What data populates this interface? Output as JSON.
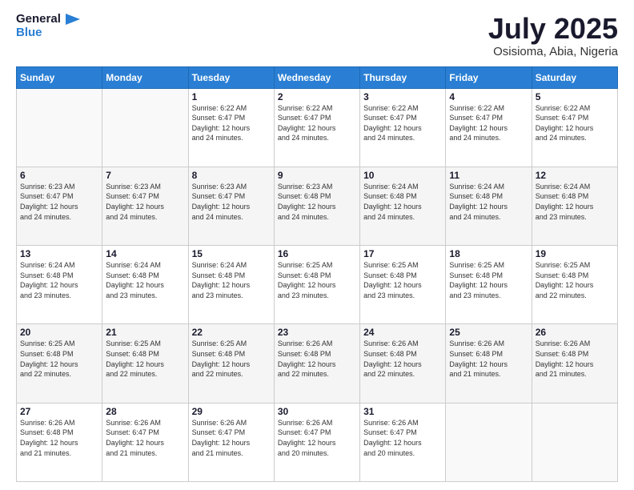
{
  "header": {
    "logo": {
      "line1": "General",
      "line2": "Blue"
    },
    "title": "July 2025",
    "subtitle": "Osisioma, Abia, Nigeria"
  },
  "weekdays": [
    "Sunday",
    "Monday",
    "Tuesday",
    "Wednesday",
    "Thursday",
    "Friday",
    "Saturday"
  ],
  "weeks": [
    [
      {
        "day": "",
        "info": ""
      },
      {
        "day": "",
        "info": ""
      },
      {
        "day": "1",
        "info": "Sunrise: 6:22 AM\nSunset: 6:47 PM\nDaylight: 12 hours\nand 24 minutes."
      },
      {
        "day": "2",
        "info": "Sunrise: 6:22 AM\nSunset: 6:47 PM\nDaylight: 12 hours\nand 24 minutes."
      },
      {
        "day": "3",
        "info": "Sunrise: 6:22 AM\nSunset: 6:47 PM\nDaylight: 12 hours\nand 24 minutes."
      },
      {
        "day": "4",
        "info": "Sunrise: 6:22 AM\nSunset: 6:47 PM\nDaylight: 12 hours\nand 24 minutes."
      },
      {
        "day": "5",
        "info": "Sunrise: 6:22 AM\nSunset: 6:47 PM\nDaylight: 12 hours\nand 24 minutes."
      }
    ],
    [
      {
        "day": "6",
        "info": "Sunrise: 6:23 AM\nSunset: 6:47 PM\nDaylight: 12 hours\nand 24 minutes."
      },
      {
        "day": "7",
        "info": "Sunrise: 6:23 AM\nSunset: 6:47 PM\nDaylight: 12 hours\nand 24 minutes."
      },
      {
        "day": "8",
        "info": "Sunrise: 6:23 AM\nSunset: 6:47 PM\nDaylight: 12 hours\nand 24 minutes."
      },
      {
        "day": "9",
        "info": "Sunrise: 6:23 AM\nSunset: 6:48 PM\nDaylight: 12 hours\nand 24 minutes."
      },
      {
        "day": "10",
        "info": "Sunrise: 6:24 AM\nSunset: 6:48 PM\nDaylight: 12 hours\nand 24 minutes."
      },
      {
        "day": "11",
        "info": "Sunrise: 6:24 AM\nSunset: 6:48 PM\nDaylight: 12 hours\nand 24 minutes."
      },
      {
        "day": "12",
        "info": "Sunrise: 6:24 AM\nSunset: 6:48 PM\nDaylight: 12 hours\nand 23 minutes."
      }
    ],
    [
      {
        "day": "13",
        "info": "Sunrise: 6:24 AM\nSunset: 6:48 PM\nDaylight: 12 hours\nand 23 minutes."
      },
      {
        "day": "14",
        "info": "Sunrise: 6:24 AM\nSunset: 6:48 PM\nDaylight: 12 hours\nand 23 minutes."
      },
      {
        "day": "15",
        "info": "Sunrise: 6:24 AM\nSunset: 6:48 PM\nDaylight: 12 hours\nand 23 minutes."
      },
      {
        "day": "16",
        "info": "Sunrise: 6:25 AM\nSunset: 6:48 PM\nDaylight: 12 hours\nand 23 minutes."
      },
      {
        "day": "17",
        "info": "Sunrise: 6:25 AM\nSunset: 6:48 PM\nDaylight: 12 hours\nand 23 minutes."
      },
      {
        "day": "18",
        "info": "Sunrise: 6:25 AM\nSunset: 6:48 PM\nDaylight: 12 hours\nand 23 minutes."
      },
      {
        "day": "19",
        "info": "Sunrise: 6:25 AM\nSunset: 6:48 PM\nDaylight: 12 hours\nand 22 minutes."
      }
    ],
    [
      {
        "day": "20",
        "info": "Sunrise: 6:25 AM\nSunset: 6:48 PM\nDaylight: 12 hours\nand 22 minutes."
      },
      {
        "day": "21",
        "info": "Sunrise: 6:25 AM\nSunset: 6:48 PM\nDaylight: 12 hours\nand 22 minutes."
      },
      {
        "day": "22",
        "info": "Sunrise: 6:25 AM\nSunset: 6:48 PM\nDaylight: 12 hours\nand 22 minutes."
      },
      {
        "day": "23",
        "info": "Sunrise: 6:26 AM\nSunset: 6:48 PM\nDaylight: 12 hours\nand 22 minutes."
      },
      {
        "day": "24",
        "info": "Sunrise: 6:26 AM\nSunset: 6:48 PM\nDaylight: 12 hours\nand 22 minutes."
      },
      {
        "day": "25",
        "info": "Sunrise: 6:26 AM\nSunset: 6:48 PM\nDaylight: 12 hours\nand 21 minutes."
      },
      {
        "day": "26",
        "info": "Sunrise: 6:26 AM\nSunset: 6:48 PM\nDaylight: 12 hours\nand 21 minutes."
      }
    ],
    [
      {
        "day": "27",
        "info": "Sunrise: 6:26 AM\nSunset: 6:48 PM\nDaylight: 12 hours\nand 21 minutes."
      },
      {
        "day": "28",
        "info": "Sunrise: 6:26 AM\nSunset: 6:47 PM\nDaylight: 12 hours\nand 21 minutes."
      },
      {
        "day": "29",
        "info": "Sunrise: 6:26 AM\nSunset: 6:47 PM\nDaylight: 12 hours\nand 21 minutes."
      },
      {
        "day": "30",
        "info": "Sunrise: 6:26 AM\nSunset: 6:47 PM\nDaylight: 12 hours\nand 20 minutes."
      },
      {
        "day": "31",
        "info": "Sunrise: 6:26 AM\nSunset: 6:47 PM\nDaylight: 12 hours\nand 20 minutes."
      },
      {
        "day": "",
        "info": ""
      },
      {
        "day": "",
        "info": ""
      }
    ]
  ]
}
